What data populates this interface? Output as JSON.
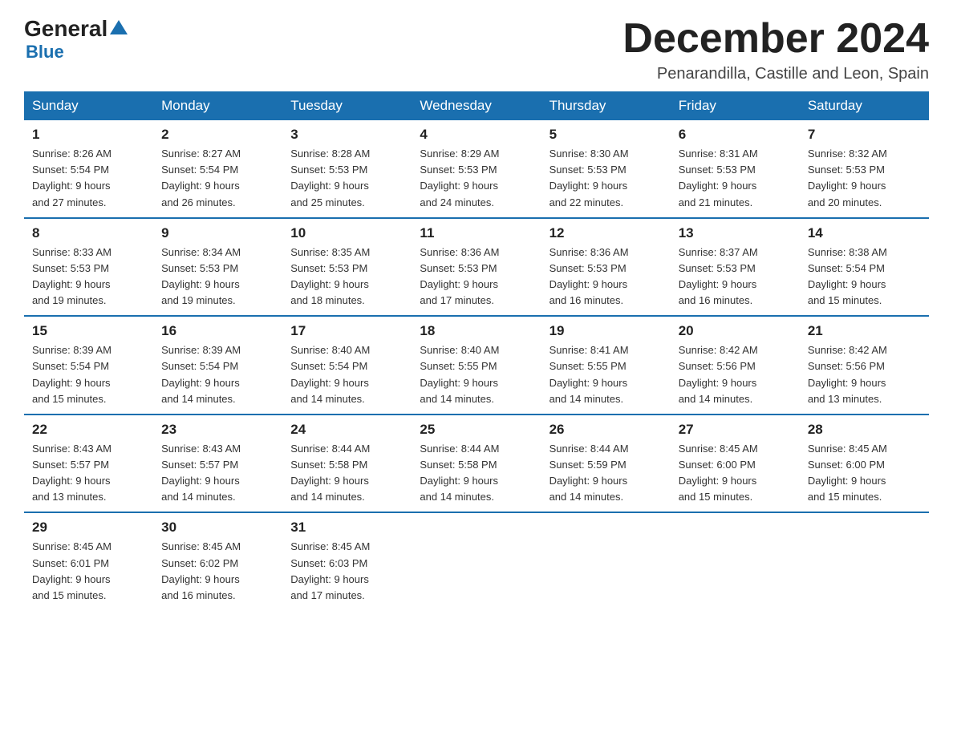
{
  "header": {
    "logo_general": "General",
    "logo_blue": "Blue",
    "title": "December 2024",
    "location": "Penarandilla, Castille and Leon, Spain"
  },
  "weekdays": [
    "Sunday",
    "Monday",
    "Tuesday",
    "Wednesday",
    "Thursday",
    "Friday",
    "Saturday"
  ],
  "weeks": [
    [
      {
        "day": "1",
        "sunrise": "8:26 AM",
        "sunset": "5:54 PM",
        "daylight": "9 hours and 27 minutes."
      },
      {
        "day": "2",
        "sunrise": "8:27 AM",
        "sunset": "5:54 PM",
        "daylight": "9 hours and 26 minutes."
      },
      {
        "day": "3",
        "sunrise": "8:28 AM",
        "sunset": "5:53 PM",
        "daylight": "9 hours and 25 minutes."
      },
      {
        "day": "4",
        "sunrise": "8:29 AM",
        "sunset": "5:53 PM",
        "daylight": "9 hours and 24 minutes."
      },
      {
        "day": "5",
        "sunrise": "8:30 AM",
        "sunset": "5:53 PM",
        "daylight": "9 hours and 22 minutes."
      },
      {
        "day": "6",
        "sunrise": "8:31 AM",
        "sunset": "5:53 PM",
        "daylight": "9 hours and 21 minutes."
      },
      {
        "day": "7",
        "sunrise": "8:32 AM",
        "sunset": "5:53 PM",
        "daylight": "9 hours and 20 minutes."
      }
    ],
    [
      {
        "day": "8",
        "sunrise": "8:33 AM",
        "sunset": "5:53 PM",
        "daylight": "9 hours and 19 minutes."
      },
      {
        "day": "9",
        "sunrise": "8:34 AM",
        "sunset": "5:53 PM",
        "daylight": "9 hours and 19 minutes."
      },
      {
        "day": "10",
        "sunrise": "8:35 AM",
        "sunset": "5:53 PM",
        "daylight": "9 hours and 18 minutes."
      },
      {
        "day": "11",
        "sunrise": "8:36 AM",
        "sunset": "5:53 PM",
        "daylight": "9 hours and 17 minutes."
      },
      {
        "day": "12",
        "sunrise": "8:36 AM",
        "sunset": "5:53 PM",
        "daylight": "9 hours and 16 minutes."
      },
      {
        "day": "13",
        "sunrise": "8:37 AM",
        "sunset": "5:53 PM",
        "daylight": "9 hours and 16 minutes."
      },
      {
        "day": "14",
        "sunrise": "8:38 AM",
        "sunset": "5:54 PM",
        "daylight": "9 hours and 15 minutes."
      }
    ],
    [
      {
        "day": "15",
        "sunrise": "8:39 AM",
        "sunset": "5:54 PM",
        "daylight": "9 hours and 15 minutes."
      },
      {
        "day": "16",
        "sunrise": "8:39 AM",
        "sunset": "5:54 PM",
        "daylight": "9 hours and 14 minutes."
      },
      {
        "day": "17",
        "sunrise": "8:40 AM",
        "sunset": "5:54 PM",
        "daylight": "9 hours and 14 minutes."
      },
      {
        "day": "18",
        "sunrise": "8:40 AM",
        "sunset": "5:55 PM",
        "daylight": "9 hours and 14 minutes."
      },
      {
        "day": "19",
        "sunrise": "8:41 AM",
        "sunset": "5:55 PM",
        "daylight": "9 hours and 14 minutes."
      },
      {
        "day": "20",
        "sunrise": "8:42 AM",
        "sunset": "5:56 PM",
        "daylight": "9 hours and 14 minutes."
      },
      {
        "day": "21",
        "sunrise": "8:42 AM",
        "sunset": "5:56 PM",
        "daylight": "9 hours and 13 minutes."
      }
    ],
    [
      {
        "day": "22",
        "sunrise": "8:43 AM",
        "sunset": "5:57 PM",
        "daylight": "9 hours and 13 minutes."
      },
      {
        "day": "23",
        "sunrise": "8:43 AM",
        "sunset": "5:57 PM",
        "daylight": "9 hours and 14 minutes."
      },
      {
        "day": "24",
        "sunrise": "8:44 AM",
        "sunset": "5:58 PM",
        "daylight": "9 hours and 14 minutes."
      },
      {
        "day": "25",
        "sunrise": "8:44 AM",
        "sunset": "5:58 PM",
        "daylight": "9 hours and 14 minutes."
      },
      {
        "day": "26",
        "sunrise": "8:44 AM",
        "sunset": "5:59 PM",
        "daylight": "9 hours and 14 minutes."
      },
      {
        "day": "27",
        "sunrise": "8:45 AM",
        "sunset": "6:00 PM",
        "daylight": "9 hours and 15 minutes."
      },
      {
        "day": "28",
        "sunrise": "8:45 AM",
        "sunset": "6:00 PM",
        "daylight": "9 hours and 15 minutes."
      }
    ],
    [
      {
        "day": "29",
        "sunrise": "8:45 AM",
        "sunset": "6:01 PM",
        "daylight": "9 hours and 15 minutes."
      },
      {
        "day": "30",
        "sunrise": "8:45 AM",
        "sunset": "6:02 PM",
        "daylight": "9 hours and 16 minutes."
      },
      {
        "day": "31",
        "sunrise": "8:45 AM",
        "sunset": "6:03 PM",
        "daylight": "9 hours and 17 minutes."
      },
      null,
      null,
      null,
      null
    ]
  ],
  "labels": {
    "sunrise": "Sunrise:",
    "sunset": "Sunset:",
    "daylight": "Daylight:"
  }
}
